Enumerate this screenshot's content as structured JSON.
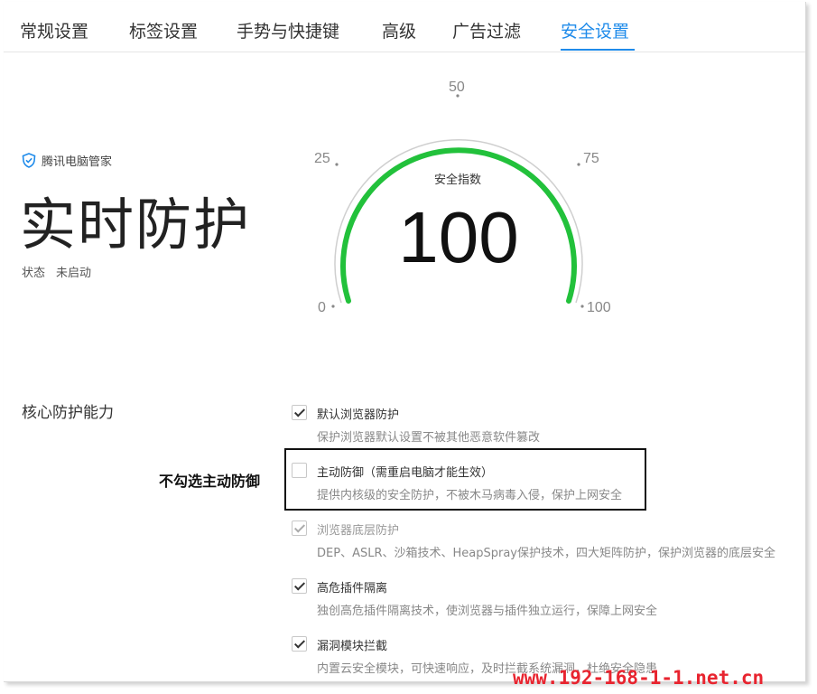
{
  "tabs": [
    {
      "label": "常规设置"
    },
    {
      "label": "标签设置"
    },
    {
      "label": "手势与快捷键"
    },
    {
      "label": "高级"
    },
    {
      "label": "广告过滤"
    },
    {
      "label": "安全设置",
      "active": true
    }
  ],
  "brand": {
    "name": "腾讯电脑管家",
    "icon": "shield-check-icon",
    "color": "#1f8bea"
  },
  "protection": {
    "title": "实时防护",
    "status_label": "状态",
    "status_value": "未启动"
  },
  "gauge": {
    "label": "安全指数",
    "value": "100",
    "ticks": [
      "0",
      "25",
      "50",
      "75",
      "100"
    ],
    "min": 0,
    "max": 100,
    "level": 100,
    "arc_color": "#22c13b"
  },
  "core": {
    "title": "核心防护能力",
    "options": [
      {
        "label": "默认浏览器防护",
        "desc": "保护浏览器默认设置不被其他恶意软件篡改",
        "checked": true
      },
      {
        "label": "主动防御（需重启电脑才能生效）",
        "desc": "提供内核级的安全防护，不被木马病毒入侵，保护上网安全",
        "checked": false
      },
      {
        "label": "浏览器底层防护",
        "desc": "DEP、ASLR、沙箱技术、HeapSpray保护技术，四大矩阵防护，保护浏览器的底层安全",
        "checked": true,
        "disabled": true
      },
      {
        "label": "高危插件隔离",
        "desc": "独创高危插件隔离技术，使浏览器与插件独立运行，保障上网安全",
        "checked": true
      },
      {
        "label": "漏洞模块拦截",
        "desc": "内置云安全模块，可快速响应，及时拦截系统漏洞，杜绝安全隐患",
        "checked": true
      }
    ]
  },
  "annotation": {
    "text": "不勾选主动防御"
  },
  "watermark": "www.192-168-1-1.net.cn"
}
